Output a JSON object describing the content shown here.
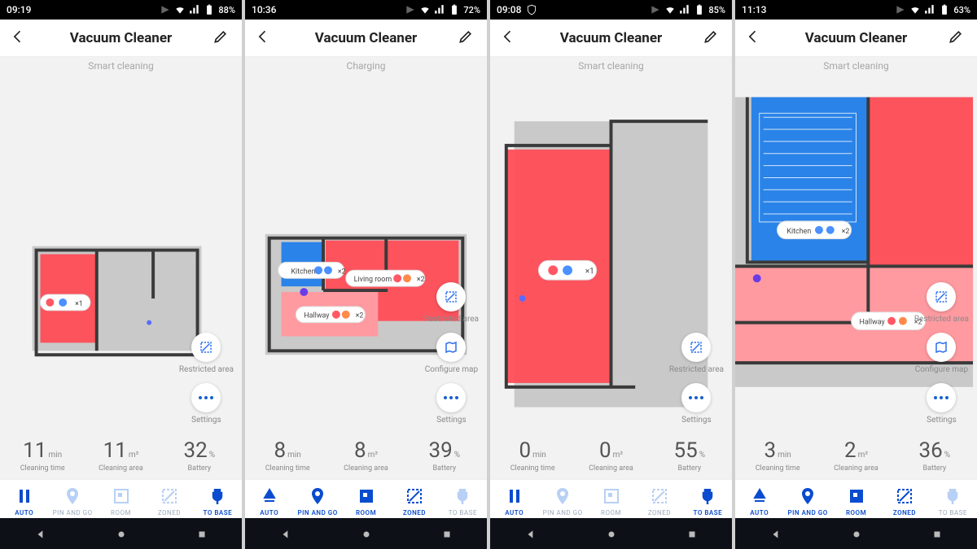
{
  "shared": {
    "header_title": "Vacuum Cleaner",
    "side_labels": {
      "restricted": "Restricted area",
      "configure": "Configure map",
      "settings": "Settings"
    },
    "stat_labels": {
      "time": "Cleaning time",
      "area": "Cleaning area",
      "battery": "Battery"
    },
    "units": {
      "time": "min",
      "area": "m²",
      "battery": "%"
    },
    "actions": [
      "AUTO",
      "PIN AND GO",
      "ROOM",
      "ZONED",
      "TO BASE"
    ]
  },
  "screens": [
    {
      "time": "09:19",
      "battery_status": "88%",
      "subtitle": "Smart cleaning",
      "stats": {
        "time": "11",
        "area": "11",
        "battery": "32"
      },
      "rooms": [
        {
          "label": "",
          "mult": "×1"
        }
      ],
      "active_action": 0,
      "side_buttons": [
        "restricted",
        "settings"
      ]
    },
    {
      "time": "10:36",
      "battery_status": "72%",
      "subtitle": "Charging",
      "stats": {
        "time": "8",
        "area": "8",
        "battery": "39"
      },
      "rooms": [
        {
          "label": "Kitchen",
          "mult": "×2"
        },
        {
          "label": "Living room",
          "mult": "×2"
        },
        {
          "label": "Hallway",
          "mult": "×2"
        }
      ],
      "active_action": 2,
      "side_buttons": [
        "restricted",
        "configure",
        "settings"
      ]
    },
    {
      "time": "09:08",
      "battery_status": "85%",
      "subtitle": "Smart cleaning",
      "stats": {
        "time": "0",
        "area": "0",
        "battery": "55"
      },
      "rooms": [
        {
          "label": "",
          "mult": "×1"
        }
      ],
      "active_action": 0,
      "side_buttons": [
        "restricted",
        "settings"
      ]
    },
    {
      "time": "11:13",
      "battery_status": "63%",
      "subtitle": "Smart cleaning",
      "stats": {
        "time": "3",
        "area": "2",
        "battery": "36"
      },
      "rooms": [
        {
          "label": "Kitchen",
          "mult": "×2"
        },
        {
          "label": "Hallway",
          "mult": "×2"
        }
      ],
      "active_action": 2,
      "side_buttons": [
        "restricted",
        "configure",
        "settings"
      ]
    }
  ]
}
